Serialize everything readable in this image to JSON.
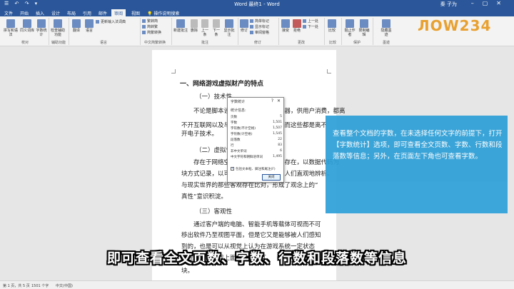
{
  "window": {
    "title": "Word 最终1 - Word",
    "user": "秦 子为",
    "min": "–",
    "max": "▢",
    "close": "✕"
  },
  "quick_access": "☰ ↶ ↷ ▾",
  "tabs": [
    {
      "label": "文件",
      "active": false
    },
    {
      "label": "开始",
      "active": false
    },
    {
      "label": "插入",
      "active": false
    },
    {
      "label": "设计",
      "active": false
    },
    {
      "label": "布局",
      "active": false
    },
    {
      "label": "引用",
      "active": false
    },
    {
      "label": "邮件",
      "active": false
    },
    {
      "label": "审阅",
      "active": true
    },
    {
      "label": "视图",
      "active": false
    },
    {
      "label": "操作说明搜索",
      "active": false
    }
  ],
  "ribbon": {
    "proofing": {
      "spelling": "拼写和语法",
      "thesaurus": "同义词库",
      "word_count": "字数统计",
      "label": "校对"
    },
    "accessibility": {
      "check": "检查辅助功能",
      "label": "辅助功能"
    },
    "language": {
      "translate": "翻译",
      "language": "语言",
      "label": "语言",
      "update_ime": "更新输入法词典"
    },
    "chinese": {
      "simp_to_trad": "繁转简",
      "trad_to_simp": "简转繁",
      "convert": "简繁转换",
      "label": "中文简繁转换"
    },
    "comments": {
      "new": "新建批注",
      "delete": "删除",
      "prev": "上一条",
      "next": "下一条",
      "show": "显示批注",
      "label": "批注"
    },
    "tracking": {
      "track": "修订",
      "markup": "简单标记",
      "show_markup": "显示标记",
      "pane": "审阅窗格",
      "label": "修订"
    },
    "changes": {
      "accept": "接受",
      "reject": "拒绝",
      "prev": "上一处",
      "next": "下一处",
      "label": "更改"
    },
    "compare": {
      "compare": "比较",
      "label": "比较"
    },
    "protect": {
      "block": "阻止作者",
      "restrict": "限制编辑",
      "label": "保护"
    },
    "ink": {
      "hide": "隐藏墨迹",
      "label": "墨迹"
    }
  },
  "logo": {
    "text": "ЛOW234"
  },
  "document": {
    "heading": "一、网络游戏虚拟财产的特点",
    "sections": [
      {
        "title": "（一）技术性"
      },
      {
        "title": "（二）虚拟性"
      },
      {
        "title": "（三）客观性"
      }
    ],
    "para1_line1": "不论是脚本设计完成后上传到服务器，供用户消费，都离",
    "para1_line2": "不开互联网以及与其相关的计算机技术而这些都是离不",
    "para1_line3": "开电子技术。",
    "para2_line1": "存在于网络空间之中，以数据形式存在，以数据代码为",
    "para2_line2": "块方式记录，以可视化的形式呈现，为人们直观地辨析。",
    "para2_line3": "与现实世界的那些客观存在比对，形成了观念上的“",
    "para2_line4": "真性”意识积淀。",
    "para3_line1": "通过客户端的电脑、智能手机等载体可视而不可",
    "para3_line2": "移出软件乃至视图平面，但是它又是能够被人们感知",
    "para3_line3": "到的，也是可以从视觉上认为在游戏系统一定状态",
    "para3_line4": "存在，地对游戏上面的设施交互",
    "para3_line5": "块。"
  },
  "dialog": {
    "title": "字数统计",
    "help": "?",
    "close_x": "✕",
    "subtitle": "统计信息:",
    "rows": [
      {
        "k": "页数",
        "v": "5"
      },
      {
        "k": "字数",
        "v": "1,501"
      },
      {
        "k": "字符数(不计空格)",
        "v": "1,507"
      },
      {
        "k": "字符数(计空格)",
        "v": "1,545"
      },
      {
        "k": "段落数",
        "v": "22"
      },
      {
        "k": "行",
        "v": "83"
      },
      {
        "k": "非中文单词",
        "v": "6"
      },
      {
        "k": "中文字符和朝鲜语单词",
        "v": "1,495"
      }
    ],
    "checkbox_label": "包括文本框、脚注和尾注(F)",
    "checkbox_checked": true,
    "close_button": "关闭"
  },
  "info_panel": {
    "text": "查看整个文档的字数，在未选择任何文字的前提下，打开【字数统计】选项，即可查看全文页数、字数、行数和段落数等信息；另外，在页面左下角也可查看字数。"
  },
  "statusbar": {
    "page": "第 1 页，共 5 页",
    "words": "1501 个字",
    "lang": "中文(中国)"
  },
  "subtitle": "即可查看全文页数、字数、行数和段落数等信息",
  "colors": {
    "brand": "#2b579a",
    "info": "#2ea0d8"
  }
}
